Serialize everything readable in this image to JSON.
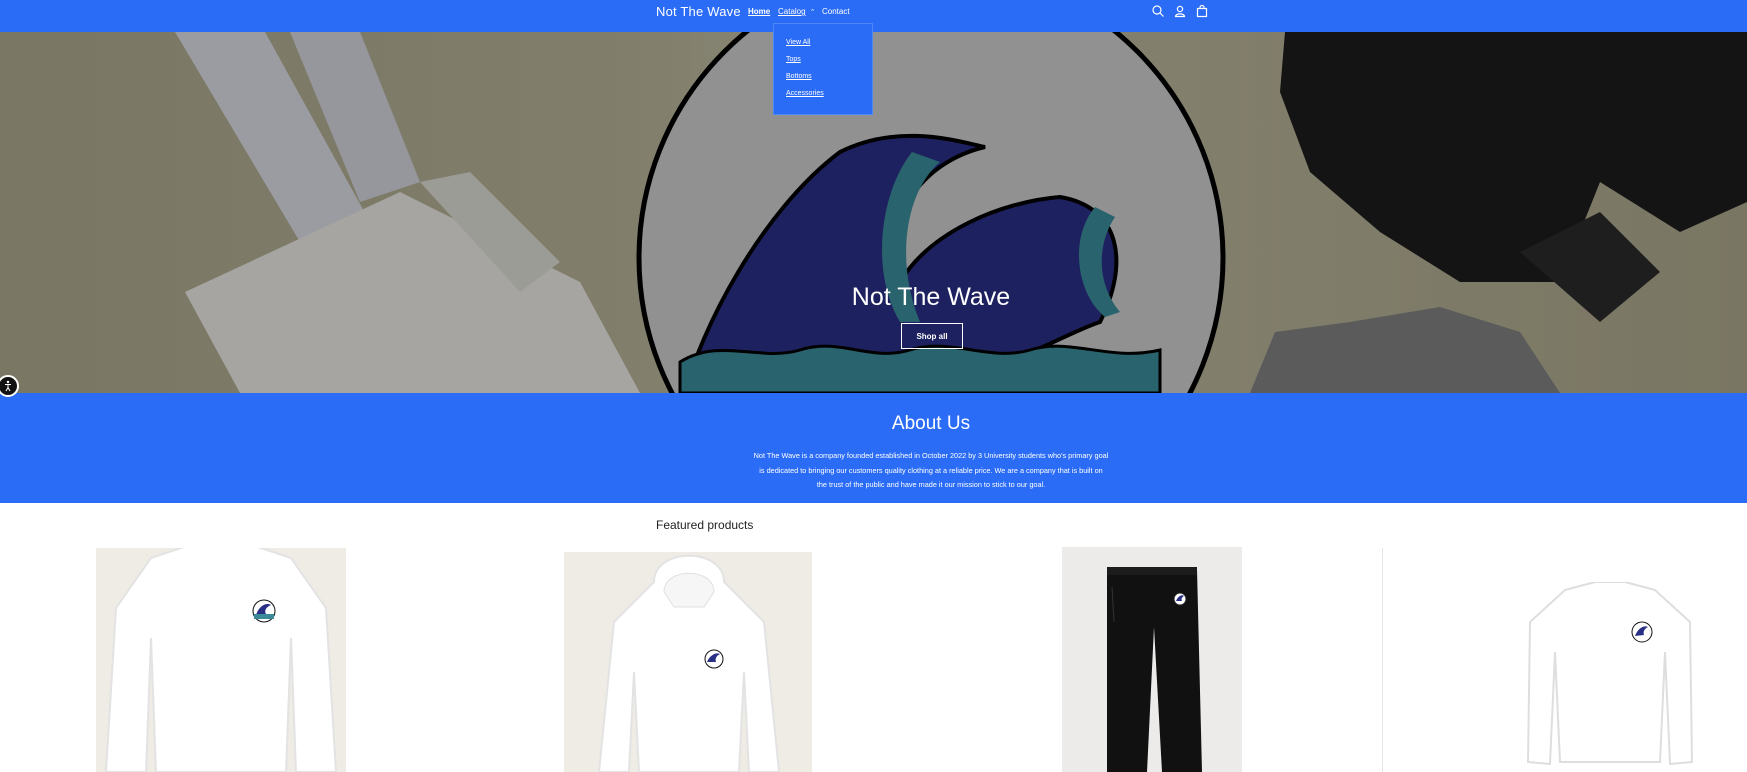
{
  "header": {
    "brand": "Not The Wave",
    "nav": {
      "home": "Home",
      "catalog": "Catalog",
      "contact": "Contact"
    },
    "icons": [
      "search-icon",
      "account-icon",
      "cart-icon"
    ]
  },
  "catalog_menu": {
    "items": [
      "View All",
      "Tops",
      "Bottoms",
      "Accessories"
    ]
  },
  "hero": {
    "title": "Not The Wave",
    "button": "Shop all"
  },
  "about": {
    "title": "About Us",
    "lines": [
      "Not The Wave is a company founded established in October 2022 by 3 University students who's primary goal",
      "is dedicated to bringing our customers quality clothing at a reliable price. We are a company that is built on",
      "the trust of the public and have made it our mission to stick to our goal."
    ]
  },
  "featured": {
    "title": "Featured products",
    "products": [
      "crewneck-sweatshirt",
      "hoodie",
      "jogger-pants",
      "long-sleeve-tee"
    ]
  },
  "colors": {
    "brand_blue": "#2b6cf6",
    "wave_navy": "#2a2f86",
    "wave_teal": "#3a8a98"
  }
}
